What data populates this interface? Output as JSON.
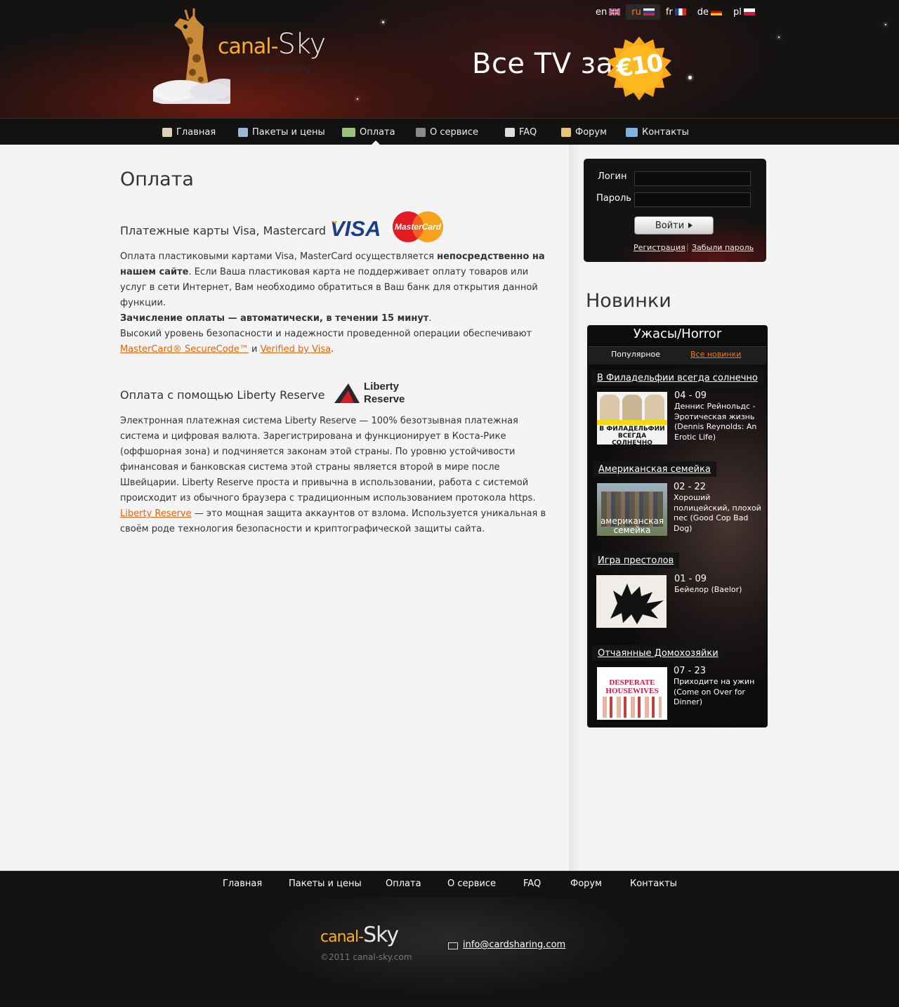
{
  "header": {
    "logo_part1": "canal-",
    "logo_part2": "Sky",
    "logo_sub": "cardsharing",
    "promo": "Все TV за",
    "price": "€10",
    "languages": [
      {
        "code": "en",
        "active": false
      },
      {
        "code": "ru",
        "active": true
      },
      {
        "code": "fr",
        "active": false
      },
      {
        "code": "de",
        "active": false
      },
      {
        "code": "pl",
        "active": false
      }
    ]
  },
  "nav": {
    "items": [
      {
        "label": "Главная",
        "icon": "home-icon"
      },
      {
        "label": "Пакеты и цены",
        "icon": "tv-icon"
      },
      {
        "label": "Оплата",
        "icon": "money-icon",
        "active": true
      },
      {
        "label": "О сервисе",
        "icon": "satellite-icon"
      },
      {
        "label": "FAQ",
        "icon": "question-icon"
      },
      {
        "label": "Форум",
        "icon": "forum-icon"
      },
      {
        "label": "Контакты",
        "icon": "contacts-icon"
      }
    ]
  },
  "main": {
    "title": "Оплата",
    "cards": {
      "title": "Платежные карты Visa, Mastercard",
      "visa_logo": "VISA",
      "mc_logo": "MasterCard",
      "p1": "Оплата пластиковыми картами Visa, MasterCard осуществляется ",
      "p1_bold": "непосредственно на нашем сайте",
      "p2": ". Если Ваша пластиковая карта не поддерживает оплату товаров или услуг в  сети Интернет, Вам необходимо обратиться в Ваш банк для открытия данной функции.",
      "p3_bold": "Зачисление оплаты — автоматически, в течении 15 минут",
      "p3_end": ".",
      "p4": "Высокий уровень безопасности и надежности проведенной операции обеспечивают",
      "link1": "MasterCard® SecureCode™",
      "and": " и ",
      "link2": "Verified by Visa",
      "end": "."
    },
    "liberty": {
      "title": "Оплата с помощью Liberty Reserve",
      "logo_line1": "Liberty",
      "logo_line2": "Reserve",
      "p1": "Электронная платежная система Liberty Reserve — 100% безотзывная платежная система и цифровая валюта. Зарегистрирована и функционирует  в Коста-Рике (оффшорная зона) и подчиняется законам этой страны. По уровню устойчивости финансовая и банковская система этой страны является второй в мире после Швейцарии. Liberty Reserve проста и привычна в использовании, работа с системой происходит из обычного браузера с традиционным использованием протокола https. ",
      "link": "Liberty Reserve",
      "p2": " — это мощная защита аккаунтов от взлома. Используется уникальная в своём роде технология безопасности и криптографической защиты сайта."
    }
  },
  "login": {
    "login_label": "Логин",
    "password_label": "Пароль",
    "button": "Войти",
    "register": "Регистрация",
    "forgot": "Забыли пароль"
  },
  "sidebar": {
    "title": "Новинки",
    "genre": "Ужасы/Horror",
    "tab_popular": "Популярное",
    "tab_all": "Все новинки",
    "shows": [
      {
        "title": "В Филадельфии всегда солнечно",
        "episode": "04 - 09",
        "name": "Деннис Рейнольдс - Эротическая жизнь (Dennis Reynolds: An Erotic Life)",
        "thumb_text": "В ФИЛАДЕЛЬФИИ ВСЕГДА СОЛНЕЧНО"
      },
      {
        "title": "Американская семейка",
        "episode": "02 - 22",
        "name": "Хороший полицейский, плохой пес (Good Cop Bad Dog)",
        "thumb_text": "американская семейка"
      },
      {
        "title": "Игра престолов",
        "episode": "01 - 09",
        "name": "Бейелор (Baelor)",
        "thumb_text": ""
      },
      {
        "title": "Отчаянные Домохозяйки",
        "episode": "07 - 23",
        "name": "Приходите на ужин (Come on Over for Dinner)",
        "thumb_text": "DESPERATE HOUSEWIVES"
      }
    ]
  },
  "footer": {
    "nav": [
      "Главная",
      "Пакеты и цены",
      "Оплата",
      "О сервисе",
      "FAQ",
      "Форум",
      "Контакты"
    ],
    "logo_part1": "canal-",
    "logo_part2": "Sky",
    "copyright": "©2011  canal-sky.com",
    "email": "info@cardsharing.com"
  },
  "colors": {
    "accent": "#f07b1a",
    "link": "#e8630c",
    "logo_orange": "#f6b120",
    "badge": "#f7a81b",
    "header_bg": "#151212"
  }
}
